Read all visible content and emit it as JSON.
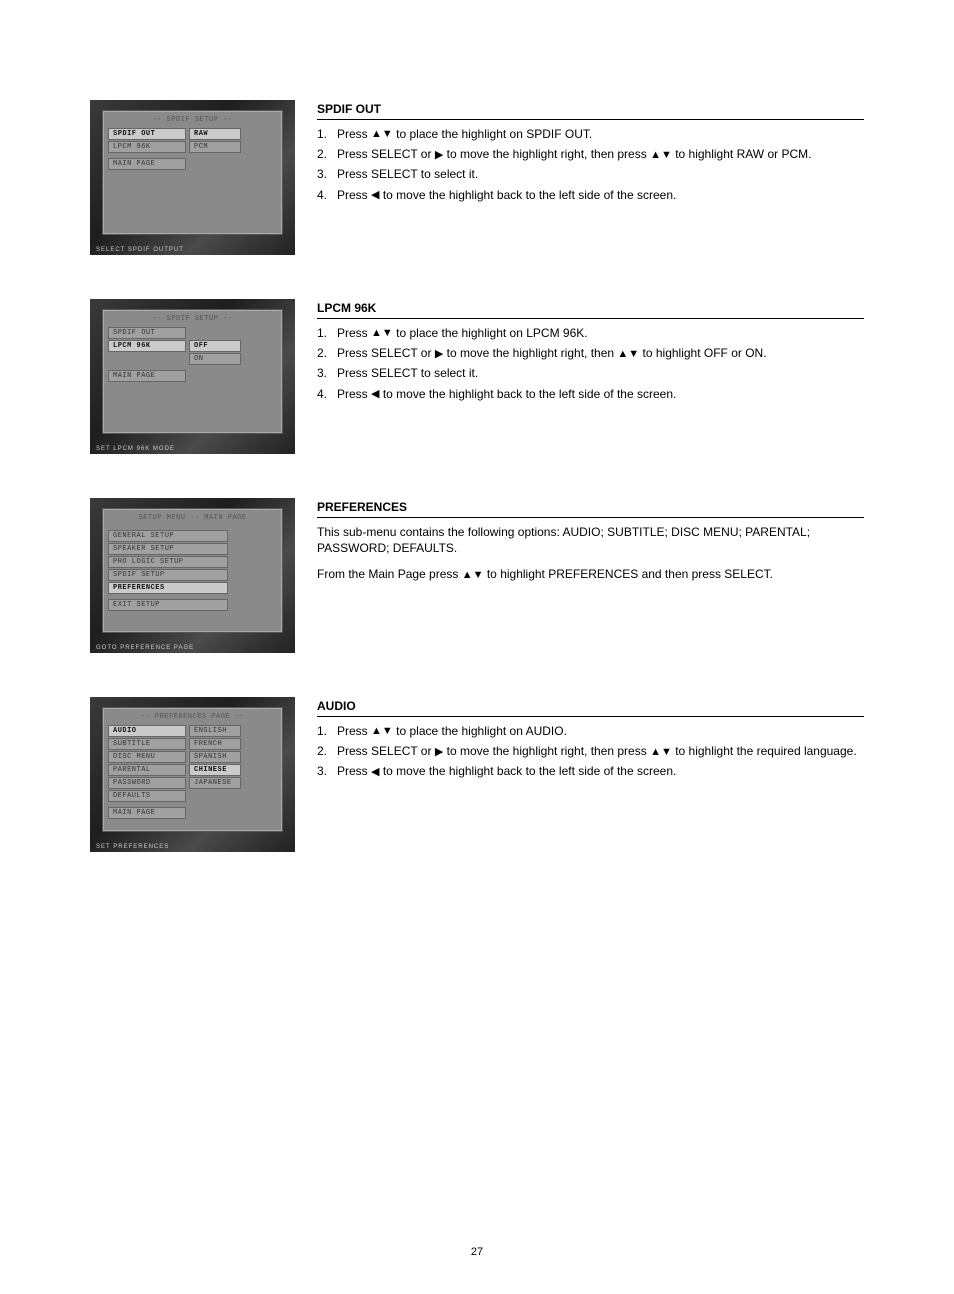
{
  "sections": {
    "spdif_out": {
      "title": "SPDIF OUT",
      "steps": [
        {
          "num": "1.",
          "text_pre": "Press ",
          "sym": "▲▼",
          "text_post": " to place the highlight on SPDIF OUT."
        },
        {
          "num": "2.",
          "text_pre": "Press SELECT or ",
          "sym": "▶",
          "text_post": " to move the highlight right, then press ",
          "sym2": "▲▼",
          "text_post2": " to highlight RAW or PCM."
        },
        {
          "num": "3.",
          "text_pre": "Press SELECT to select it.",
          "sym": "",
          "text_post": ""
        },
        {
          "num": "4.",
          "text_pre": "Press ",
          "sym": "◀",
          "text_post": " to move the highlight back to the left side of the screen."
        }
      ],
      "osd": {
        "title": "-- SPDIF SETUP --",
        "left": [
          "SPDIF OUT",
          "LPCM 96K"
        ],
        "right": [
          "RAW",
          "PCM"
        ],
        "main": "MAIN PAGE",
        "hint": "SELECT SPDIF OUTPUT",
        "hl_left_index": 0,
        "hl_right_index": 0
      }
    },
    "lpcm96k": {
      "title": "LPCM 96K",
      "steps": [
        {
          "num": "1.",
          "text_pre": "Press ",
          "sym": "▲▼",
          "text_post": " to place the highlight on LPCM 96K."
        },
        {
          "num": "2.",
          "text_pre": "Press SELECT or ",
          "sym": "▶",
          "text_post": " to move the highlight right, then ",
          "sym2": "▲▼",
          "text_post2": " to highlight OFF or ON."
        },
        {
          "num": "3.",
          "text_pre": "Press SELECT to select it.",
          "sym": "",
          "text_post": ""
        },
        {
          "num": "4.",
          "text_pre": "Press ",
          "sym": "◀",
          "text_post": " to move the highlight back to the left side of the screen."
        }
      ],
      "osd": {
        "title": "-- SPDIF SETUP --",
        "left": [
          "SPDIF OUT",
          "LPCM 96K"
        ],
        "right": [
          "OFF",
          "ON"
        ],
        "main": "MAIN PAGE",
        "hint": "SET LPCM 96K MODE",
        "hl_left_index": 1,
        "hl_right_index": 0
      }
    },
    "preferences": {
      "title": "PREFERENCES",
      "intro": "This sub-menu contains the following options: AUDIO; SUBTITLE; DISC MENU; PARENTAL; PASSWORD; DEFAULTS.",
      "line2_pre": "From the Main Page press ",
      "line2_sym": "▲▼",
      "line2_post": " to highlight PREFERENCES and then press SELECT.",
      "osd": {
        "title": "SETUP MENU -- MAIN PAGE",
        "items": [
          "GENERAL SETUP",
          "SPEAKER SETUP",
          "PRO LOGIC SETUP",
          "SPDIF SETUP",
          "PREFERENCES"
        ],
        "exit": "EXIT SETUP",
        "hint": "GOTO PREFERENCE PAGE",
        "hl_index": 4
      }
    },
    "audio": {
      "title": "AUDIO",
      "steps": [
        {
          "num": "1.",
          "text_pre": "Press ",
          "sym": "▲▼",
          "text_post": " to place the highlight on AUDIO."
        },
        {
          "num": "2.",
          "text_pre": "Press SELECT or ",
          "sym": "▶",
          "text_post": " to move the highlight right, then press ",
          "sym2": "▲▼",
          "text_post2": " to highlight the required language."
        },
        {
          "num": "3.",
          "text_pre": "Press ",
          "sym": "◀",
          "text_post": " to move the highlight back to the left side of the screen."
        }
      ],
      "osd": {
        "title": "-- PREFERENCES PAGE --",
        "left": [
          "AUDIO",
          "SUBTITLE",
          "DISC MENU",
          "PARENTAL",
          "PASSWORD",
          "DEFAULTS"
        ],
        "right": [
          "ENGLISH",
          "FRENCH",
          "SPANISH",
          "CHINESE",
          "JAPANESE"
        ],
        "main": "MAIN PAGE",
        "hint": "SET PREFERENCES",
        "hl_left_index": 0,
        "hl_right_index": 3
      }
    }
  },
  "footer": "27"
}
